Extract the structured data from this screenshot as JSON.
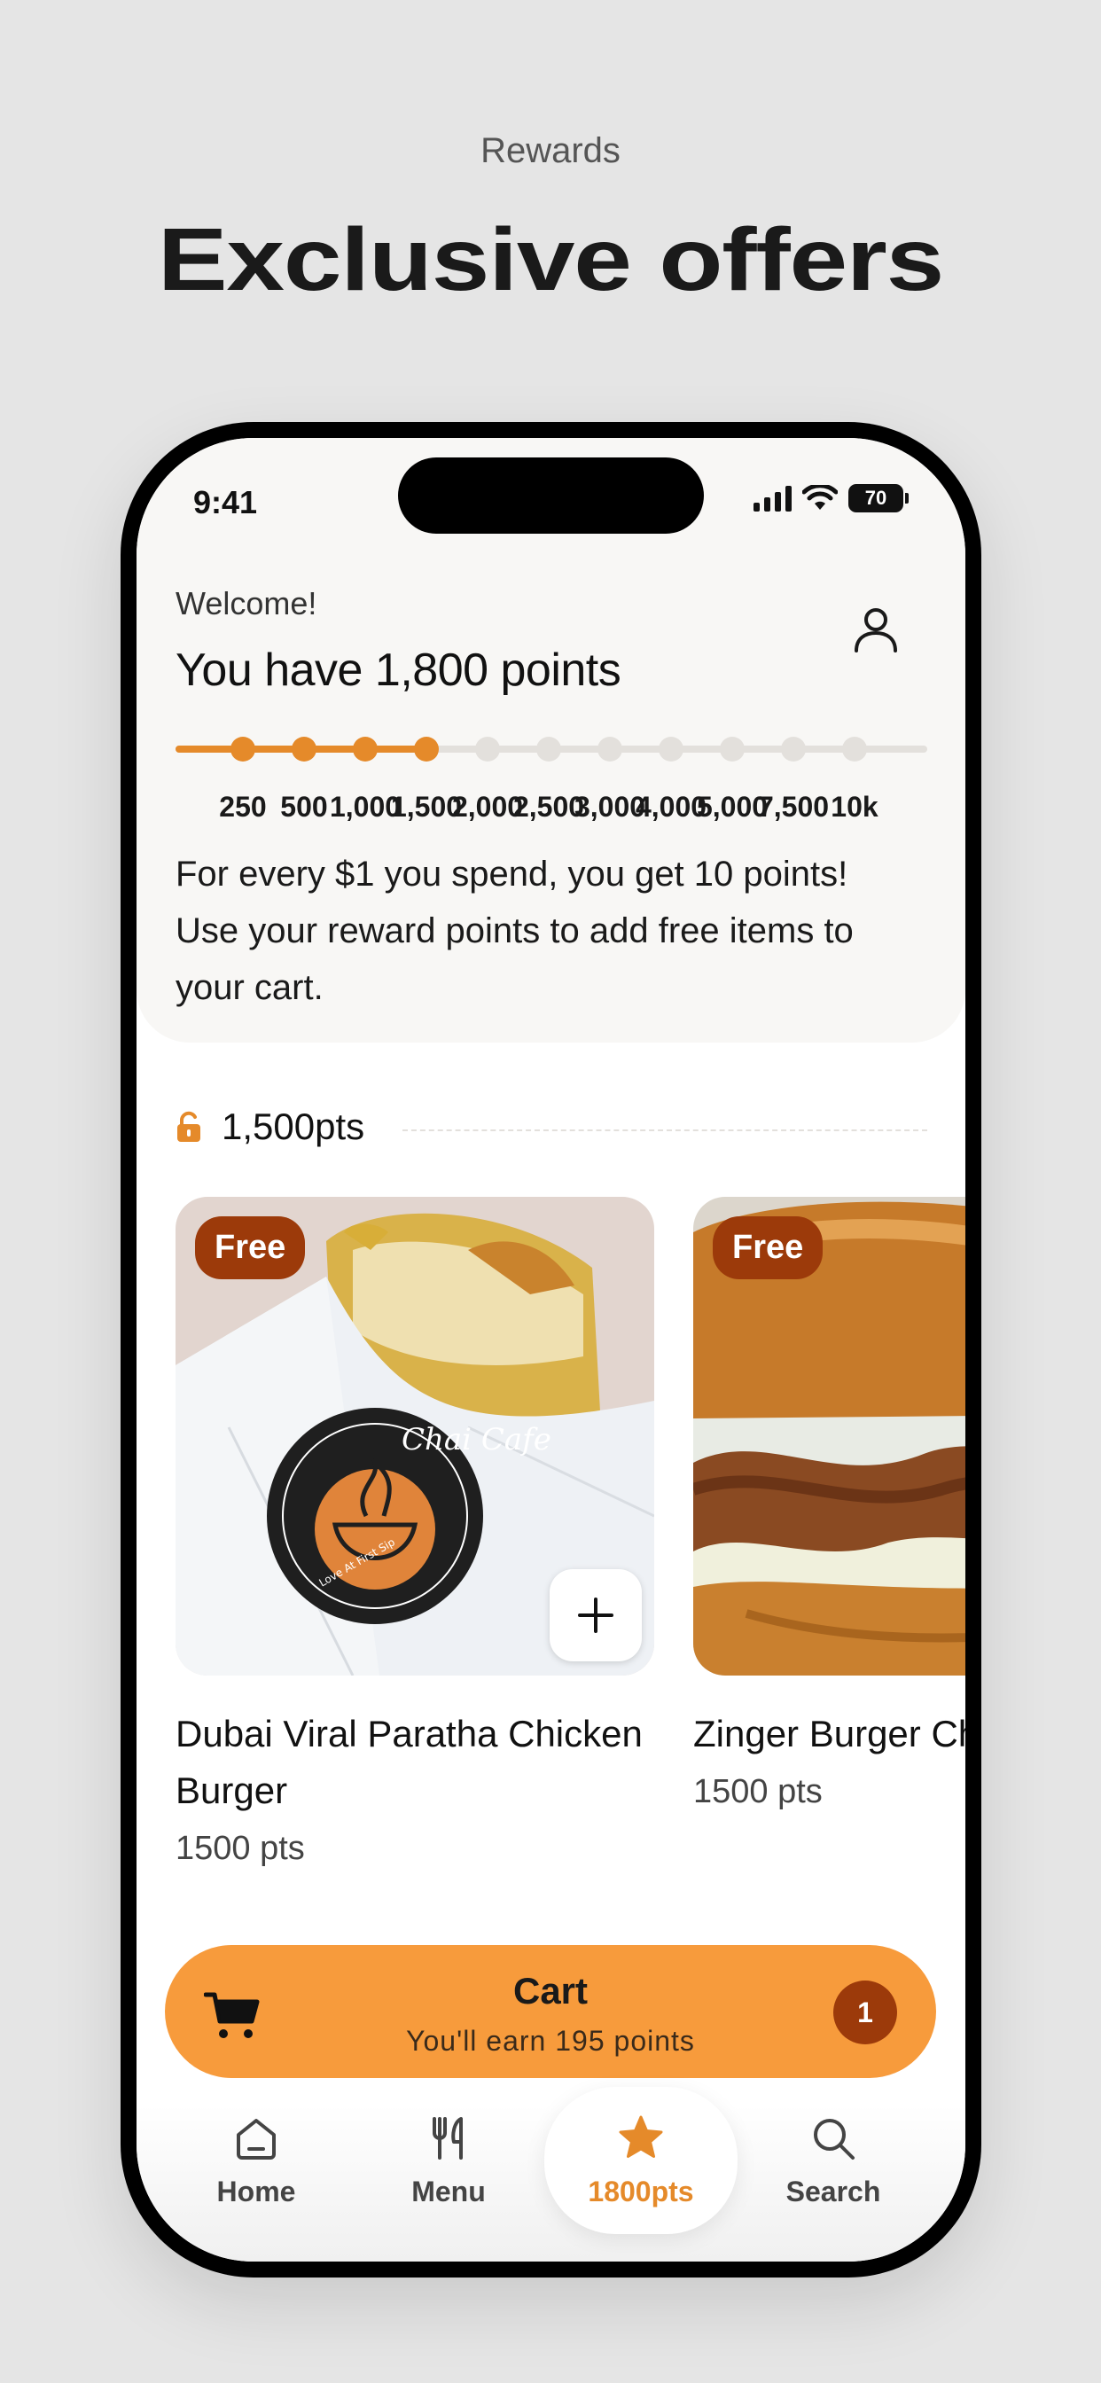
{
  "hero": {
    "subtitle": "Rewards",
    "title": "Exclusive offers"
  },
  "status_bar": {
    "time": "9:41",
    "battery": "70"
  },
  "header": {
    "welcome": "Welcome!",
    "points_title": "You have 1,800 points"
  },
  "progress": {
    "current_points": 1800,
    "milestones": [
      "250",
      "500",
      "1,000",
      "1,500",
      "2,000",
      "2,500",
      "3,000",
      "4,000",
      "5,000",
      "7,500",
      "10k"
    ],
    "reached_count": 4
  },
  "info_text": "For every $1 you spend, you get 10 points! Use your reward points to add free items to your cart.",
  "tier": {
    "label": "1,500pts",
    "icon": "unlock-icon"
  },
  "items": [
    {
      "badge": "Free",
      "name": "Dubai Viral Paratha Chicken Burger",
      "points": "1500 pts",
      "logo_text": "Chai Cafe",
      "logo_tagline": "Love At First Sip"
    },
    {
      "badge": "Free",
      "name": "Zinger Burger Chicken",
      "points": "1500 pts"
    }
  ],
  "cart": {
    "title": "Cart",
    "subtitle": "You'll earn 195 points",
    "count": "1"
  },
  "nav": [
    {
      "label": "Home",
      "icon": "home-icon"
    },
    {
      "label": "Menu",
      "icon": "utensils-icon"
    },
    {
      "label": "1800pts",
      "icon": "star-icon",
      "active": true
    },
    {
      "label": "Search",
      "icon": "search-icon"
    }
  ],
  "colors": {
    "accent": "#e58a2a",
    "cart": "#f79b3c",
    "badge": "#9c3a0a",
    "track": "#e3e0dc"
  }
}
